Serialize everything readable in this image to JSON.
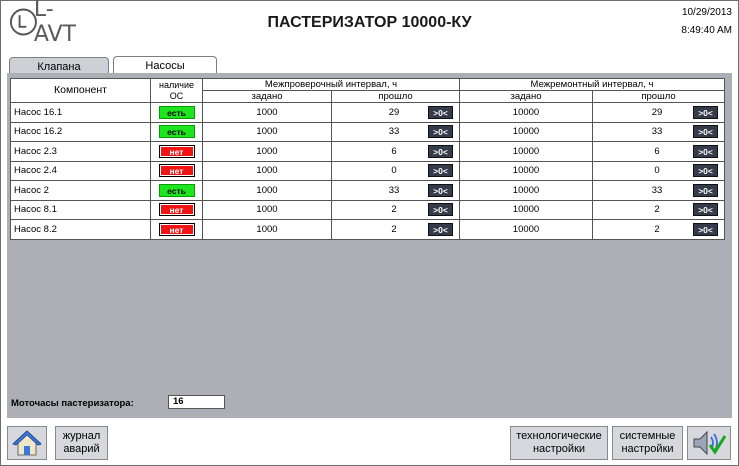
{
  "header": {
    "logo_text": "L-AVT",
    "title": "ПАСТЕРИЗАТОР 10000-КУ",
    "date": "10/29/2013",
    "time": "8:49:40 AM"
  },
  "tabs": [
    {
      "label": "Клапана",
      "active": false
    },
    {
      "label": "Насосы",
      "active": true
    }
  ],
  "table": {
    "col_component": "Компонент",
    "col_os": "наличие ОС",
    "group_inspection": "Межпроверочный интервал, ч",
    "group_repair": "Межремонтный интервал, ч",
    "sub_set": "задано",
    "sub_elapsed": "прошло",
    "reset_label": ">0<",
    "rows": [
      {
        "name": "Насос 16.1",
        "os": "есть",
        "insp_set": "1000",
        "insp_elapsed": "29",
        "rep_set": "10000",
        "rep_elapsed": "29"
      },
      {
        "name": "Насос 16.2",
        "os": "есть",
        "insp_set": "1000",
        "insp_elapsed": "33",
        "rep_set": "10000",
        "rep_elapsed": "33"
      },
      {
        "name": "Насос 2.3",
        "os": "нет",
        "insp_set": "1000",
        "insp_elapsed": "6",
        "rep_set": "10000",
        "rep_elapsed": "6"
      },
      {
        "name": "Насос 2.4",
        "os": "нет",
        "insp_set": "1000",
        "insp_elapsed": "0",
        "rep_set": "10000",
        "rep_elapsed": "0"
      },
      {
        "name": "Насос 2",
        "os": "есть",
        "insp_set": "1000",
        "insp_elapsed": "33",
        "rep_set": "10000",
        "rep_elapsed": "33"
      },
      {
        "name": "Насос 8.1",
        "os": "нет",
        "insp_set": "1000",
        "insp_elapsed": "2",
        "rep_set": "10000",
        "rep_elapsed": "2"
      },
      {
        "name": "Насос 8.2",
        "os": "нет",
        "insp_set": "1000",
        "insp_elapsed": "2",
        "rep_set": "10000",
        "rep_elapsed": "2"
      }
    ]
  },
  "motor_hours": {
    "label": "Моточасы пастеризатора:",
    "value": "16"
  },
  "buttons": {
    "journal": "журнал\nаварий",
    "tech": "технологические\nнастройки",
    "sys": "системные\nнастройки"
  },
  "colors": {
    "ok": "#1ee61e",
    "fail": "#f01414",
    "panel": "#aeafb6",
    "reset_button": "#343b4a"
  },
  "icons": {
    "home": "home-icon",
    "sound": "sound-ok-icon"
  }
}
